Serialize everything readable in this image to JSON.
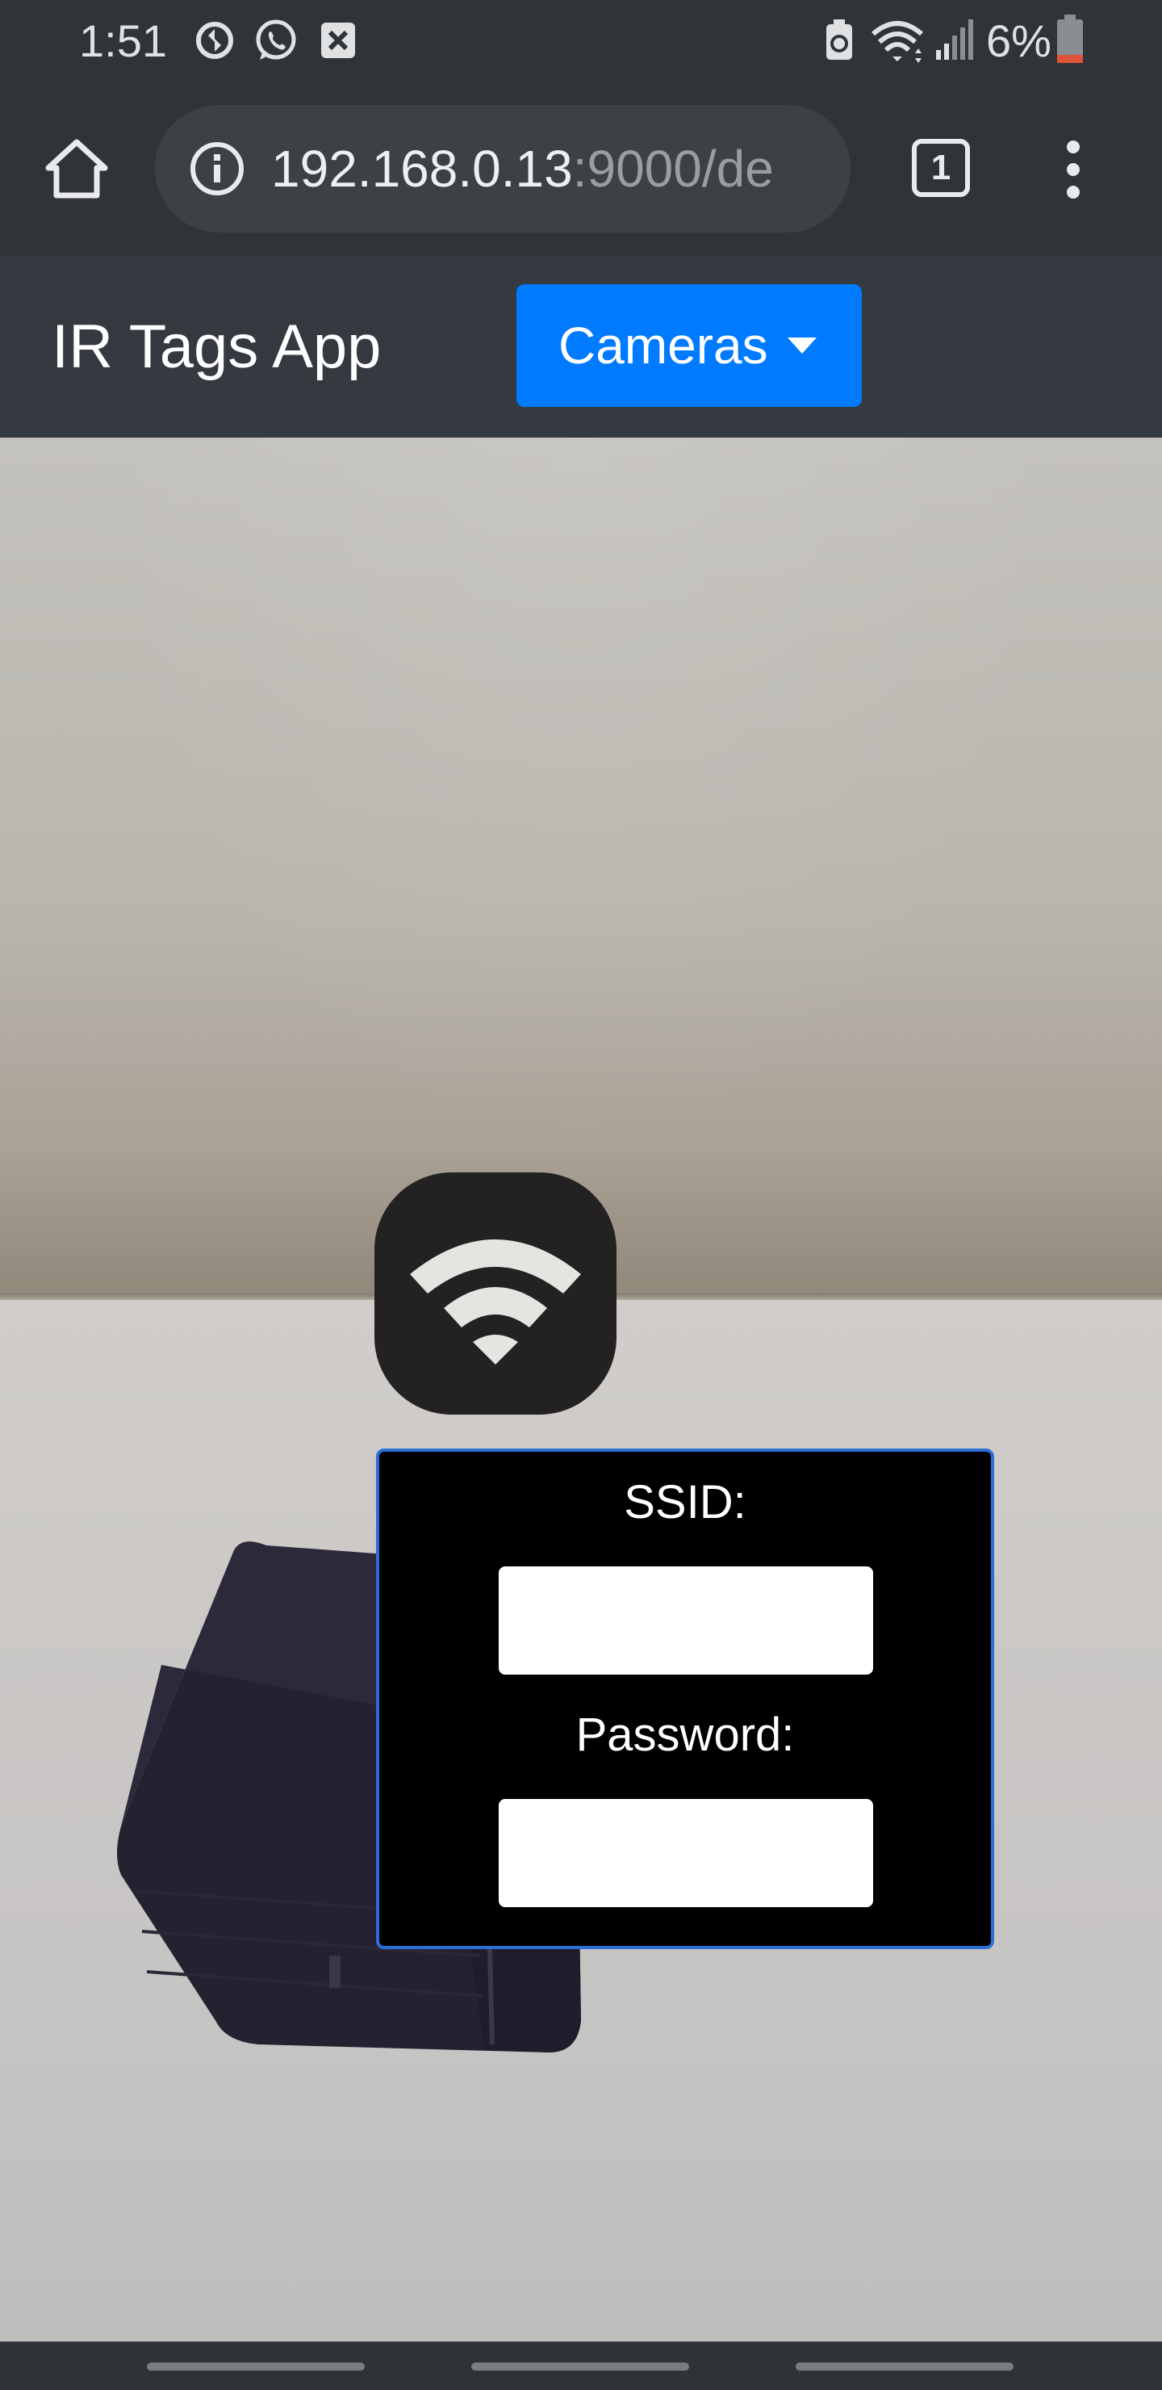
{
  "status_bar": {
    "time": "1:51",
    "battery_percent": "6%",
    "icons": [
      "sync-icon",
      "whatsapp-icon",
      "close-box-icon",
      "battery-saver-icon",
      "wifi-icon",
      "signal-icon",
      "battery-icon"
    ]
  },
  "browser": {
    "url_host": "192.168.0.13",
    "url_rest": ":9000/de",
    "tab_count": "1",
    "icons": [
      "home-icon",
      "info-icon",
      "tabs-icon",
      "more-vert-icon"
    ]
  },
  "navbar": {
    "brand": "IR Tags App",
    "cameras_button": "Cameras"
  },
  "tag_overlay": {
    "icon": "wifi-icon",
    "ssid_label": "SSID:",
    "ssid_value": "",
    "password_label": "Password:",
    "password_value": ""
  },
  "colors": {
    "accent": "#007bff",
    "navbar_bg": "#343a40",
    "browser_bg": "#303337",
    "panel_border": "#2b6fd6"
  }
}
